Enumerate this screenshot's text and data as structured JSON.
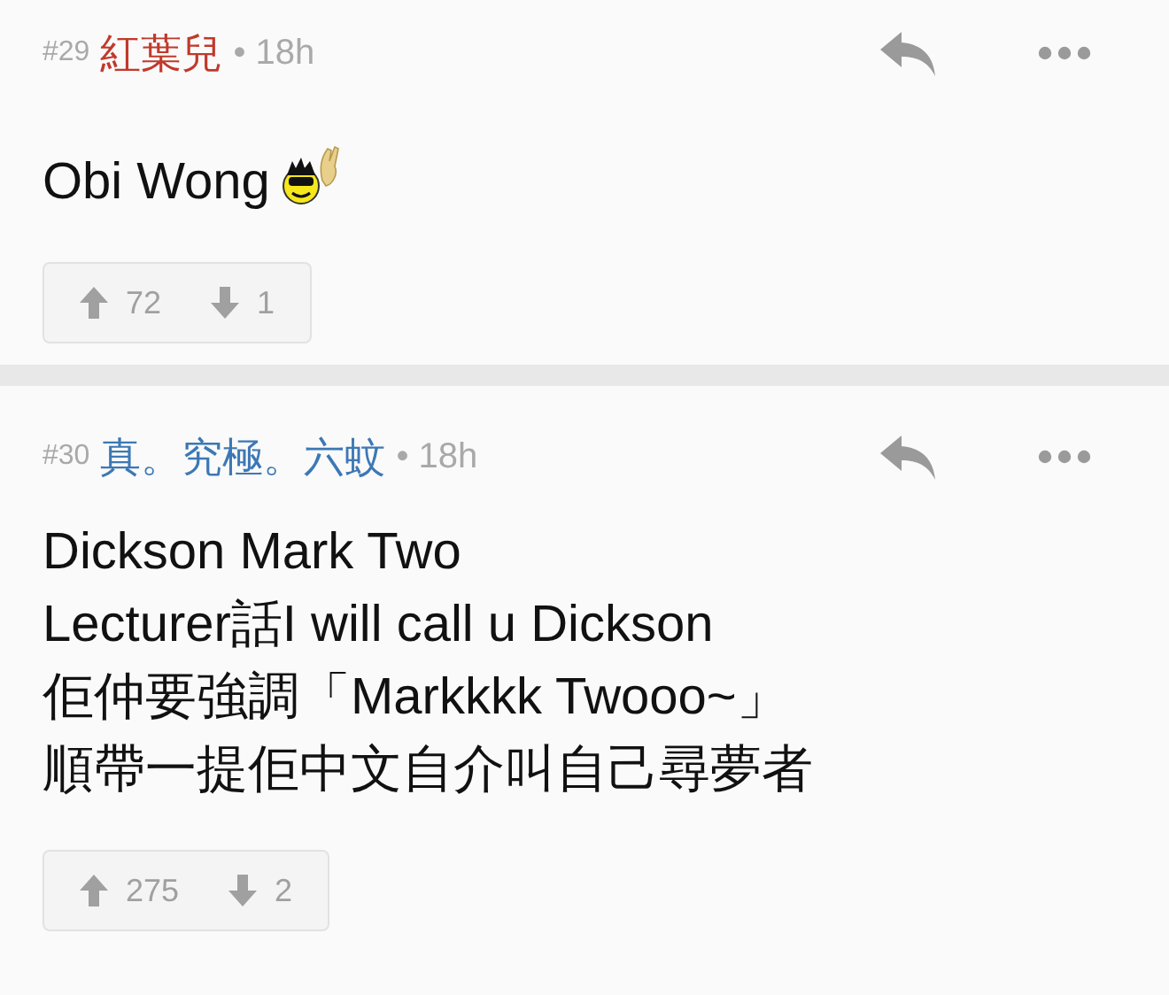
{
  "posts": [
    {
      "number": "#29",
      "author": "紅葉兒",
      "color": "#c0392b",
      "time": "• 18h",
      "lines": [
        "Obi Wong"
      ],
      "emoticon": true,
      "upvotes": "72",
      "downvotes": "1"
    },
    {
      "number": "#30",
      "author": "真。究極。六蚊",
      "color": "#3d78b5",
      "time": "• 18h",
      "lines": [
        "Dickson Mark Two",
        "Lecturer話I will call u Dickson",
        "佢仲要強調「Markkkk Twooo~」",
        "順帶一提佢中文自介叫自己尋夢者"
      ],
      "emoticon": false,
      "upvotes": "275",
      "downvotes": "2"
    }
  ]
}
